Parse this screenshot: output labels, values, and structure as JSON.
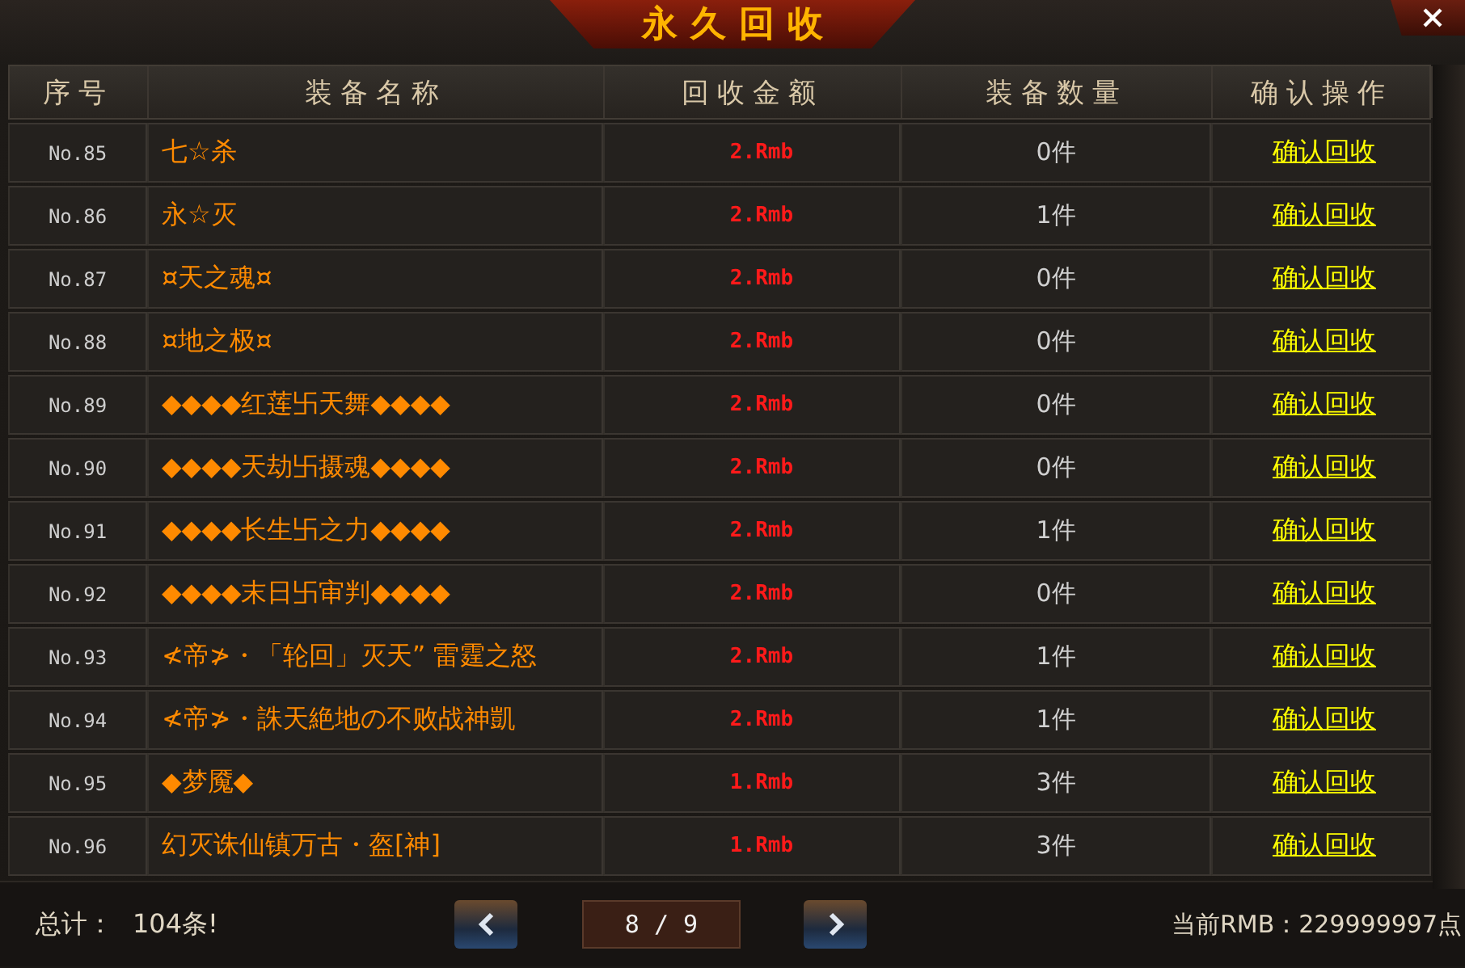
{
  "window": {
    "title": "永久回收"
  },
  "table": {
    "columns": [
      "序号",
      "装备名称",
      "回收金额",
      "装备数量",
      "确认操作"
    ],
    "rows": [
      {
        "no": "No.85",
        "name": "七☆杀",
        "amount": "2.Rmb",
        "quantity": "0件",
        "action": "确认回收"
      },
      {
        "no": "No.86",
        "name": "永☆灭",
        "amount": "2.Rmb",
        "quantity": "1件",
        "action": "确认回收"
      },
      {
        "no": "No.87",
        "name": "¤天之魂¤",
        "amount": "2.Rmb",
        "quantity": "0件",
        "action": "确认回收"
      },
      {
        "no": "No.88",
        "name": "¤地之极¤",
        "amount": "2.Rmb",
        "quantity": "0件",
        "action": "确认回收"
      },
      {
        "no": "No.89",
        "name": "◆◆◆◆红莲卐天舞◆◆◆◆",
        "amount": "2.Rmb",
        "quantity": "0件",
        "action": "确认回收"
      },
      {
        "no": "No.90",
        "name": "◆◆◆◆天劫卐摄魂◆◆◆◆",
        "amount": "2.Rmb",
        "quantity": "0件",
        "action": "确认回收"
      },
      {
        "no": "No.91",
        "name": "◆◆◆◆长生卐之力◆◆◆◆",
        "amount": "2.Rmb",
        "quantity": "1件",
        "action": "确认回收"
      },
      {
        "no": "No.92",
        "name": "◆◆◆◆末日卐审判◆◆◆◆",
        "amount": "2.Rmb",
        "quantity": "0件",
        "action": "确认回收"
      },
      {
        "no": "No.93",
        "name": "≮帝≯・「轮回」灭天” 雷霆之怒",
        "amount": "2.Rmb",
        "quantity": "1件",
        "action": "确认回收"
      },
      {
        "no": "No.94",
        "name": "≮帝≯・誅天絶地の不败战神凱",
        "amount": "2.Rmb",
        "quantity": "1件",
        "action": "确认回收"
      },
      {
        "no": "No.95",
        "name": "◆梦魇◆",
        "amount": "1.Rmb",
        "quantity": "3件",
        "action": "确认回收"
      },
      {
        "no": "No.96",
        "name": "幻灭诛仙镇万古・盔[神]",
        "amount": "1.Rmb",
        "quantity": "3件",
        "action": "确认回收"
      }
    ]
  },
  "footer": {
    "total_label": "总计：",
    "total": "104条!",
    "page": "8 / 9",
    "balance": "当前RMB：229999997点"
  }
}
